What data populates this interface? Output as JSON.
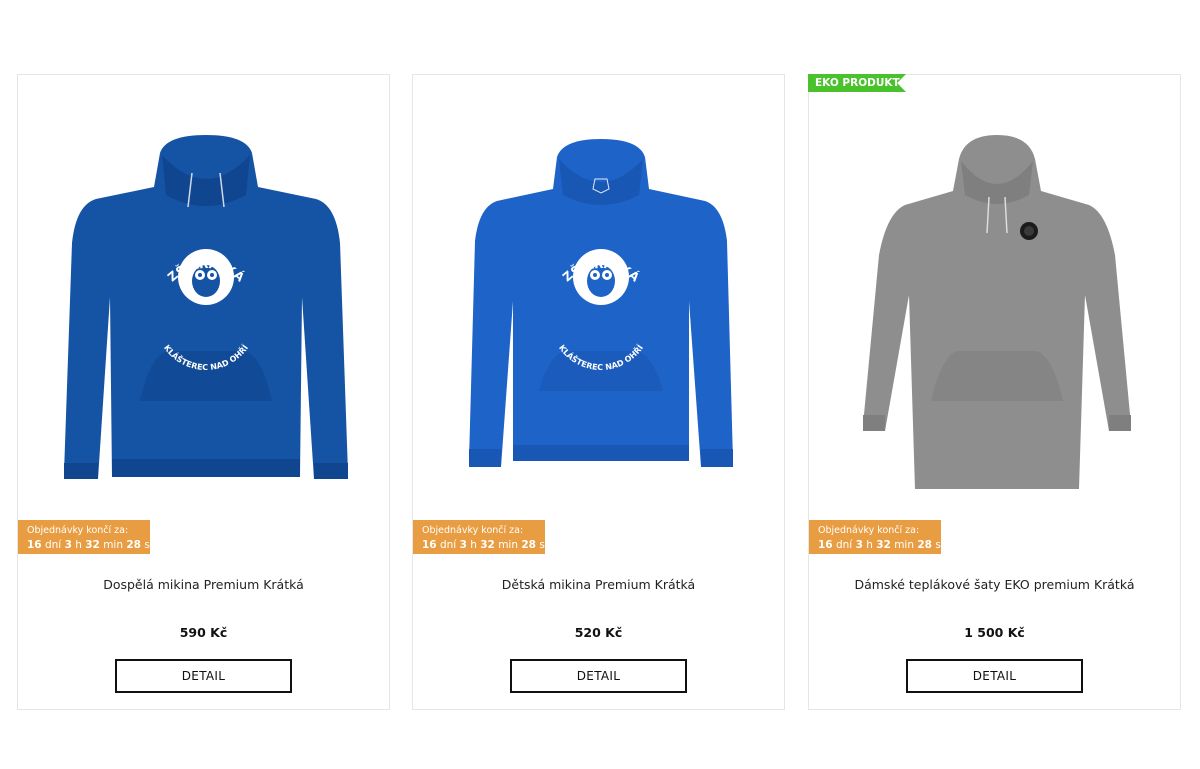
{
  "colors": {
    "badge_green": "#49c22c",
    "countdown_orange": "#e99d43",
    "hoodie_blue_dark": "#1553a5",
    "hoodie_blue_bright": "#1e63c8",
    "dress_grey": "#8e8e8e"
  },
  "products": [
    {
      "badge": "",
      "image_icon": "blue-hoodie-owl-logo",
      "countdown_label": "Objednávky končí za:",
      "countdown": {
        "days": "16",
        "days_unit": "dní",
        "hours": "3",
        "hours_unit": "h",
        "minutes": "32",
        "minutes_unit": "min",
        "seconds": "28",
        "seconds_unit": "s"
      },
      "name": "Dospělá mikina Premium Krátká",
      "price": "590 Kč",
      "button": "DETAIL"
    },
    {
      "badge": "",
      "image_icon": "blue-kids-hoodie-owl-logo",
      "countdown_label": "Objednávky končí za:",
      "countdown": {
        "days": "16",
        "days_unit": "dní",
        "hours": "3",
        "hours_unit": "h",
        "minutes": "32",
        "minutes_unit": "min",
        "seconds": "28",
        "seconds_unit": "s"
      },
      "name": "Dětská mikina Premium Krátká",
      "price": "520 Kč",
      "button": "DETAIL"
    },
    {
      "badge": "EKO PRODUKT",
      "image_icon": "grey-hoodie-dress",
      "countdown_label": "Objednávky končí za:",
      "countdown": {
        "days": "16",
        "days_unit": "dní",
        "hours": "3",
        "hours_unit": "h",
        "minutes": "32",
        "minutes_unit": "min",
        "seconds": "28",
        "seconds_unit": "s"
      },
      "name": "Dámské teplákové šaty EKO premium Krátká",
      "price": "1 500 Kč",
      "button": "DETAIL"
    }
  ],
  "logo_text": {
    "top": "ZŠ KRÁTKÁ",
    "bottom": "KLÁŠTEREC NAD OHŘÍ"
  }
}
